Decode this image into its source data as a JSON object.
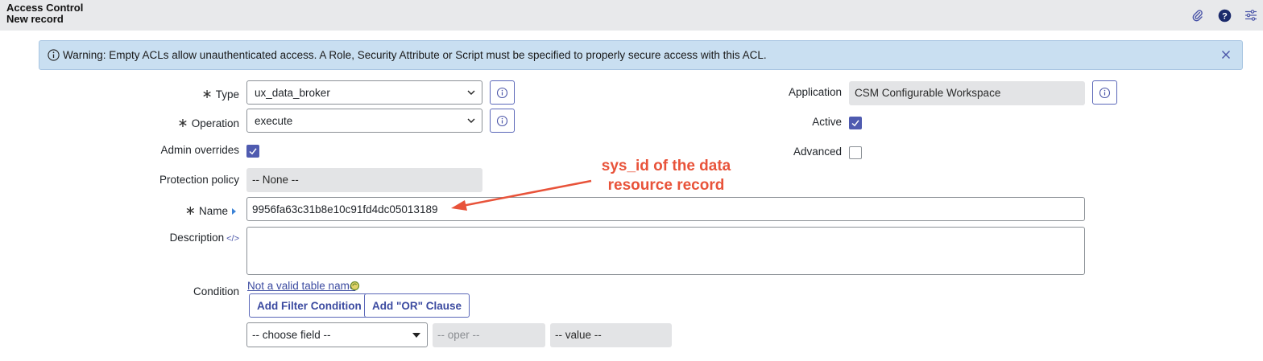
{
  "header": {
    "title": "Access Control",
    "subtitle": "New record",
    "icons": [
      "paperclip-icon",
      "help-icon",
      "settings-sliders-icon"
    ]
  },
  "banner": {
    "text": "Warning: Empty ACLs allow unauthenticated access. A Role, Security Attribute or Script must be specified to properly secure access with this ACL.",
    "icon": "info-icon",
    "close_icon": "close-icon"
  },
  "form": {
    "type": {
      "label": "Type",
      "value": "ux_data_broker",
      "required": true
    },
    "operation": {
      "label": "Operation",
      "value": "execute",
      "required": true
    },
    "admin_overrides": {
      "label": "Admin overrides",
      "checked": true
    },
    "protection_policy": {
      "label": "Protection policy",
      "value": "-- None --"
    },
    "name": {
      "label": "Name",
      "value": "9956fa63c31b8e10c91fd4dc05013189",
      "required": true
    },
    "description": {
      "label": "Description",
      "value": ""
    },
    "application": {
      "label": "Application",
      "value": "CSM Configurable Workspace"
    },
    "active": {
      "label": "Active",
      "checked": true
    },
    "advanced": {
      "label": "Advanced",
      "checked": false
    },
    "condition": {
      "label": "Condition",
      "link_text": "Not a valid table name",
      "add_filter_label": "Add Filter Condition",
      "add_or_label": "Add \"OR\" Clause",
      "field_placeholder": "-- choose field --",
      "oper_placeholder": "-- oper --",
      "value_placeholder": "-- value --"
    }
  },
  "annotation": {
    "line1": "sys_id of the data",
    "line2": "resource record",
    "color": "#e8533a"
  },
  "colors": {
    "accent": "#4f5bb0",
    "banner_bg": "#c9dff1",
    "header_bg": "#e8e9eb"
  }
}
